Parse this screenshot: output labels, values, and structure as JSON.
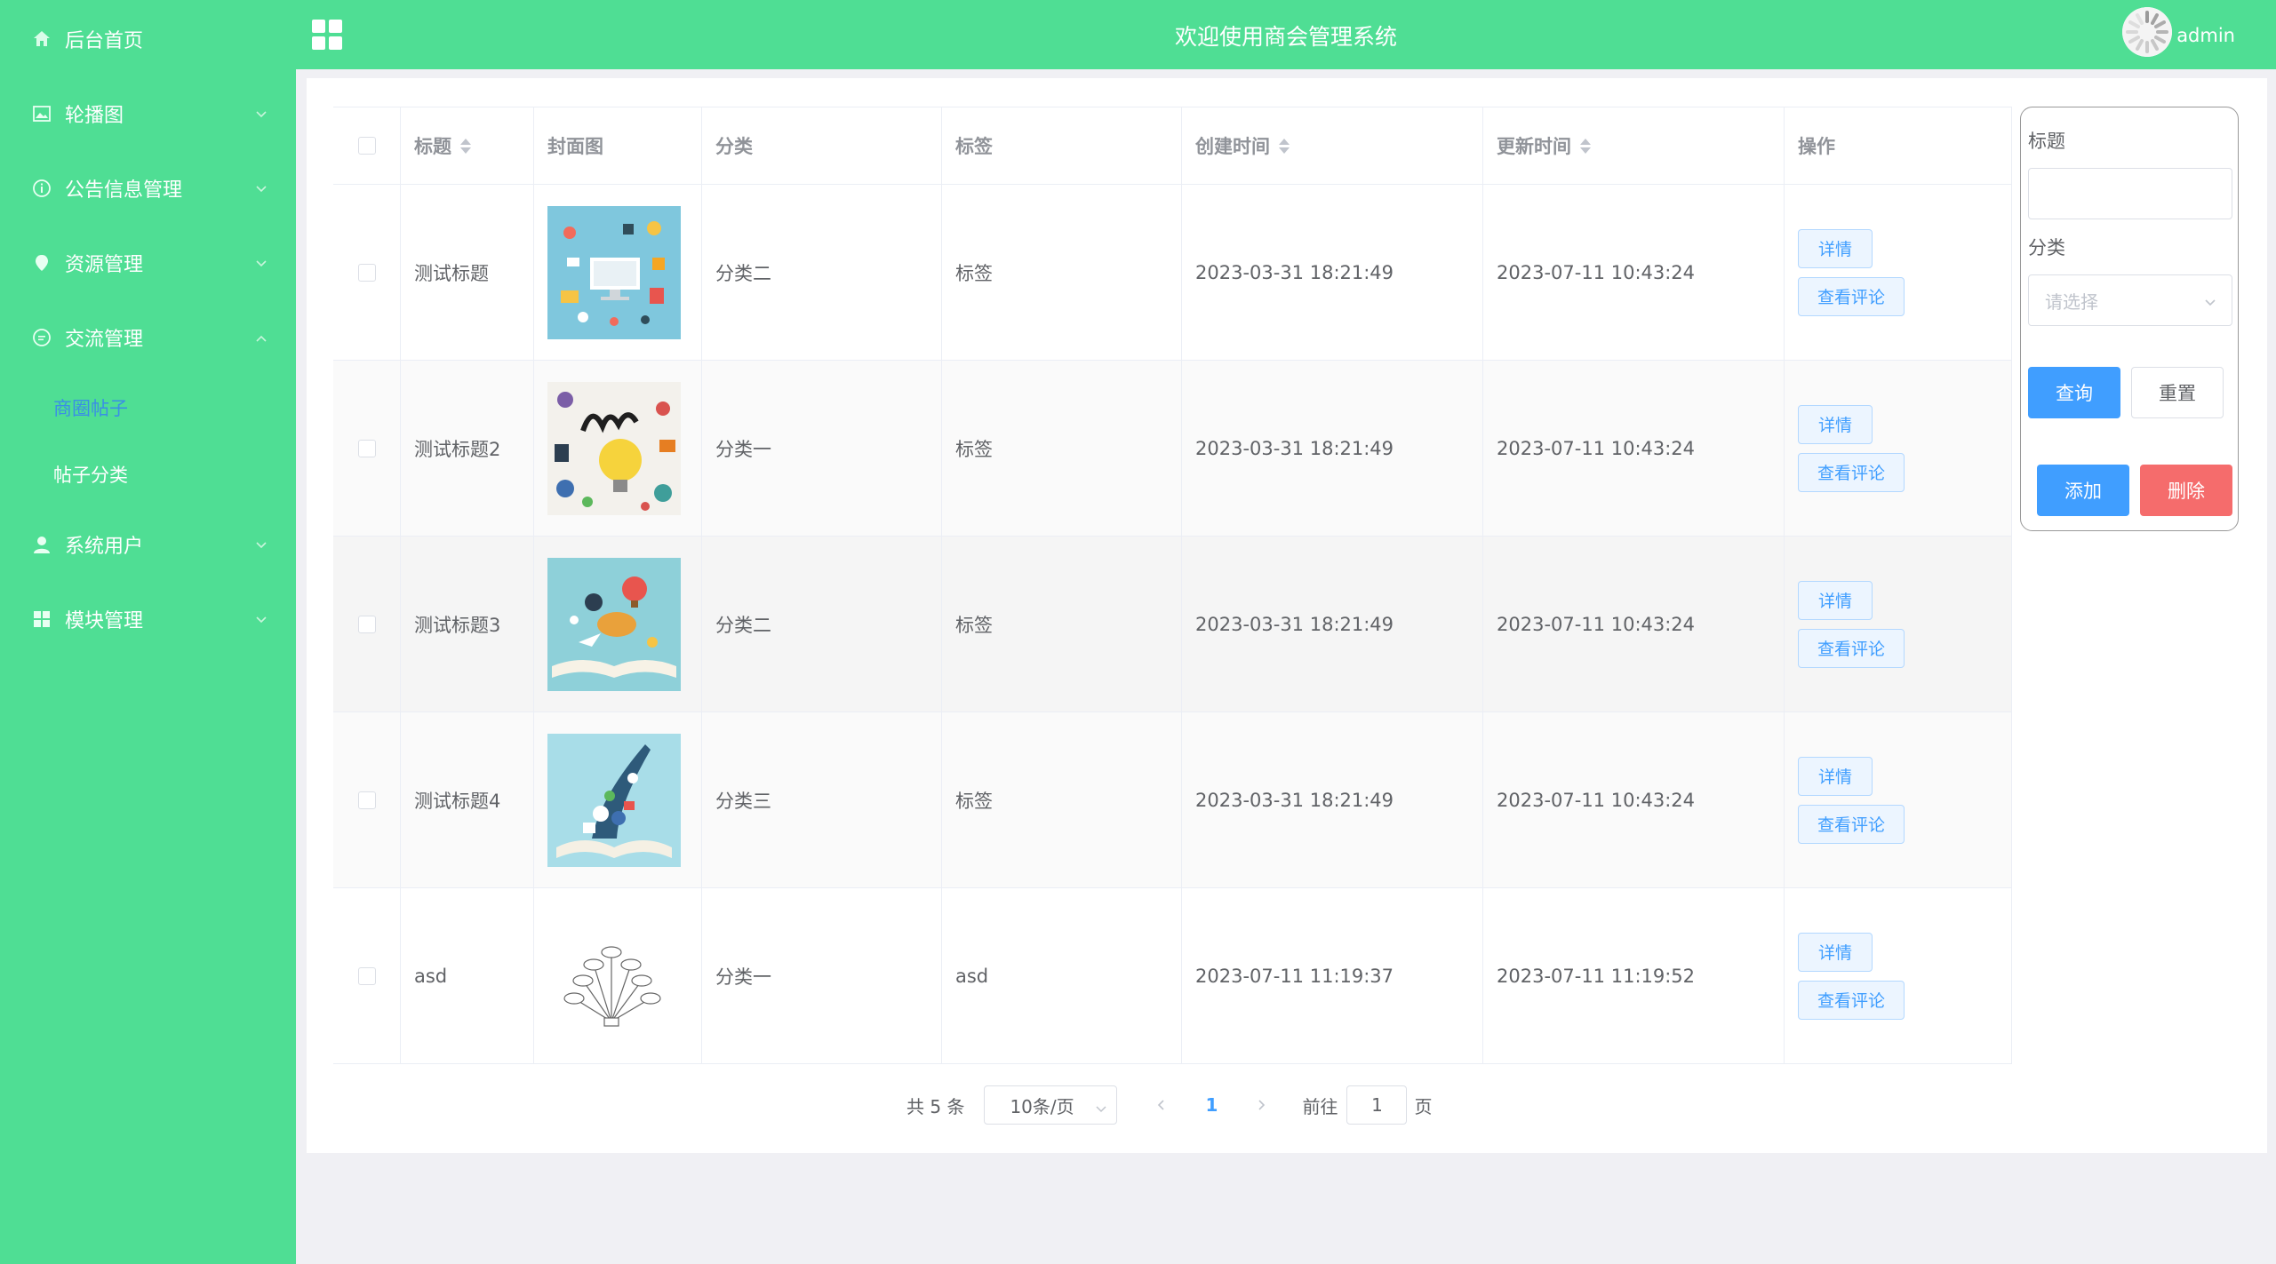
{
  "sidebar": {
    "items": [
      {
        "label": "后台首页",
        "icon": "home-icon"
      },
      {
        "label": "轮播图",
        "icon": "image-icon"
      },
      {
        "label": "公告信息管理",
        "icon": "info-icon"
      },
      {
        "label": "资源管理",
        "icon": "location-icon"
      },
      {
        "label": "交流管理",
        "icon": "chat-icon"
      },
      {
        "label": "系统用户",
        "icon": "user-icon"
      },
      {
        "label": "模块管理",
        "icon": "grid-icon"
      }
    ],
    "sub_items": [
      {
        "label": "商圈帖子",
        "active": true
      },
      {
        "label": "帖子分类",
        "active": false
      }
    ]
  },
  "header": {
    "title": "欢迎使用商会管理系统",
    "username": "admin"
  },
  "table": {
    "columns": [
      "标题",
      "封面图",
      "分类",
      "标签",
      "创建时间",
      "更新时间",
      "操作"
    ],
    "rows": [
      {
        "title": "测试标题",
        "category": "分类二",
        "tag": "标签",
        "created": "2023-03-31 18:21:49",
        "updated": "2023-07-11 10:43:24",
        "cover": "icons-collage"
      },
      {
        "title": "测试标题2",
        "category": "分类一",
        "tag": "标签",
        "created": "2023-03-31 18:21:49",
        "updated": "2023-07-11 10:43:24",
        "cover": "learn-bulb"
      },
      {
        "title": "测试标题3",
        "category": "分类二",
        "tag": "标签",
        "created": "2023-03-31 18:21:49",
        "updated": "2023-07-11 10:43:24",
        "cover": "open-book-balloon"
      },
      {
        "title": "测试标题4",
        "category": "分类三",
        "tag": "标签",
        "created": "2023-03-31 18:21:49",
        "updated": "2023-07-11 10:43:24",
        "cover": "book-rocket"
      },
      {
        "title": "asd",
        "category": "分类一",
        "tag": "asd",
        "created": "2023-07-11 11:19:37",
        "updated": "2023-07-11 11:19:52",
        "cover": "network-diagram"
      }
    ],
    "detail_label": "详情",
    "comments_label": "查看评论"
  },
  "search": {
    "title_label": "标题",
    "title_value": "",
    "category_label": "分类",
    "category_placeholder": "请选择",
    "query_label": "查询",
    "reset_label": "重置",
    "add_label": "添加",
    "delete_label": "删除"
  },
  "pagination": {
    "total_text": "共 5 条",
    "page_size": "10条/页",
    "current_page": "1",
    "goto_prefix": "前往",
    "goto_value": "1",
    "goto_suffix": "页"
  },
  "colors": {
    "brand": "#4fde94",
    "primary": "#409eff",
    "danger": "#f56c6c",
    "active_sub": "#3a8ee6"
  }
}
